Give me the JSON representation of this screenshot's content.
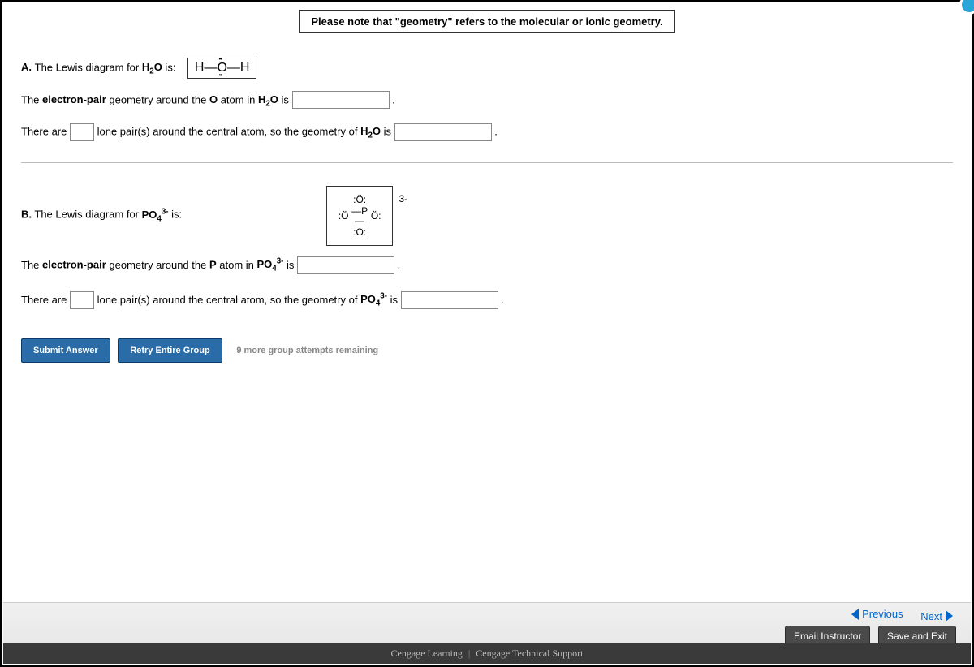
{
  "note": "Please note that \"geometry\" refers to the molecular or ionic geometry.",
  "partA": {
    "label": "A.",
    "intro_pre": "The Lewis diagram for ",
    "formula_main": "H",
    "formula_sub": "2",
    "formula_rest": "O",
    "intro_post": " is:",
    "q1_pre": "The ",
    "q1_bold": "electron-pair",
    "q1_mid": " geometry around the ",
    "q1_atom": "O",
    "q1_mid2": " atom in ",
    "q1_post": " is ",
    "q2_pre": "There are ",
    "q2_mid": " lone pair(s) around the central atom, so the geometry of ",
    "q2_post": " is "
  },
  "partB": {
    "label": "B.",
    "intro_pre": "The Lewis diagram for ",
    "formula_main": "PO",
    "formula_sub": "4",
    "formula_sup": "3-",
    "intro_post": " is:",
    "charge": "3-",
    "q1_pre": "The ",
    "q1_bold": "electron-pair",
    "q1_mid": " geometry around the ",
    "q1_atom": "P",
    "q1_mid2": " atom in ",
    "q1_post": " is ",
    "q2_pre": "There are ",
    "q2_mid": " lone pair(s) around the central atom, so the geometry of ",
    "q2_post": " is "
  },
  "buttons": {
    "submit": "Submit Answer",
    "retry": "Retry Entire Group",
    "attempts": "9 more group attempts remaining"
  },
  "nav": {
    "previous": "Previous",
    "next": "Next",
    "email": "Email Instructor",
    "save": "Save and Exit"
  },
  "footer": {
    "left": "Cengage Learning",
    "right": "Cengage Technical Support"
  }
}
